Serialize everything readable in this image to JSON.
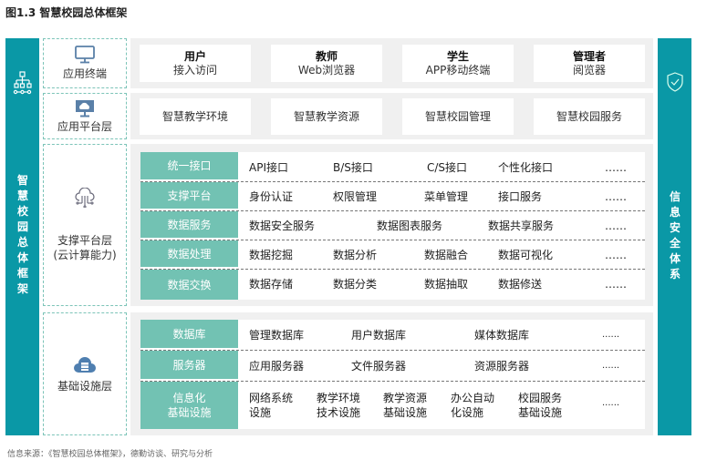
{
  "title": "图1.3 智慧校园总体框架",
  "left_bar": "智慧校园总体框架",
  "right_bar": "信息安全体系",
  "layers": {
    "terminal": {
      "label": "应用终端",
      "cards": [
        {
          "title": "用户",
          "sub": "接入访问"
        },
        {
          "title": "教师",
          "sub": "Web浏览器"
        },
        {
          "title": "学生",
          "sub": "APP移动终端"
        },
        {
          "title": "管理者",
          "sub": "阅览器"
        }
      ]
    },
    "platform": {
      "label": "应用平台层",
      "cards": [
        "智慧教学环境",
        "智慧教学资源",
        "智慧校园管理",
        "智慧校园服务"
      ]
    },
    "support": {
      "label": "支撑平台层",
      "label2": "(云计算能力)",
      "rows": [
        {
          "label": "统一接口",
          "items": [
            "API接口",
            "B/S接口",
            "C/S接口",
            "个性化接口",
            "……"
          ]
        },
        {
          "label": "支撑平台",
          "items": [
            "身份认证",
            "权限管理",
            "菜单管理",
            "接口服务",
            "……"
          ]
        },
        {
          "label": "数据服务",
          "items": [
            "数据安全服务",
            "数据图表服务",
            "数据共享服务",
            "……"
          ]
        },
        {
          "label": "数据处理",
          "items": [
            "数据挖掘",
            "数据分析",
            "数据融合",
            "数据可视化",
            "……"
          ]
        },
        {
          "label": "数据交换",
          "items": [
            "数据存储",
            "数据分类",
            "数据抽取",
            "数据修送",
            "……"
          ]
        }
      ]
    },
    "infra": {
      "label": "基础设施层",
      "rows": [
        {
          "label": "数据库",
          "items": [
            "管理数据库",
            "用户数据库",
            "媒体数据库",
            "......"
          ]
        },
        {
          "label": "服务器",
          "items": [
            "应用服务器",
            "文件服务器",
            "资源服务器",
            "......"
          ]
        },
        {
          "label": "信息化\n基础设施",
          "label_a": "信息化",
          "label_b": "基础设施",
          "items": [
            [
              "网络系统",
              "设施"
            ],
            [
              "教学环境",
              "技术设施"
            ],
            [
              "教学资源",
              "基础设施"
            ],
            [
              "办公自动",
              "化设施"
            ],
            [
              "校园服务",
              "基础设施"
            ],
            "......"
          ]
        }
      ]
    }
  },
  "footer": "信息来源：《智慧校园总体框架》，德勤访谈、研究与分析"
}
